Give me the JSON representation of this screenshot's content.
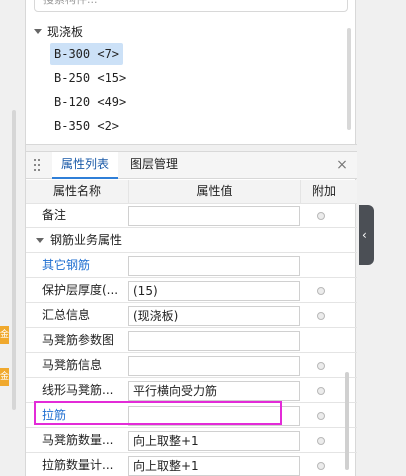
{
  "search": {
    "text": "搜索构件..."
  },
  "tree": {
    "group_label": "现浇板",
    "items": [
      {
        "label": "B-300 <7>",
        "selected": true
      },
      {
        "label": "B-250 <15>",
        "selected": false
      },
      {
        "label": "B-120 <49>",
        "selected": false
      },
      {
        "label": "B-350 <2>",
        "selected": false
      }
    ]
  },
  "left_badges": [
    "金",
    "金"
  ],
  "panel": {
    "tabs": [
      {
        "label": "属性列表",
        "active": true
      },
      {
        "label": "图层管理",
        "active": false
      }
    ],
    "close_glyph": "×"
  },
  "grid": {
    "headers": {
      "name": "属性名称",
      "value": "属性值",
      "add": "附加"
    },
    "rows": [
      {
        "type": "prop",
        "name": "备注",
        "value": "",
        "blue": false,
        "checkbox": true
      },
      {
        "type": "group",
        "name": "钢筋业务属性"
      },
      {
        "type": "prop",
        "name": "其它钢筋",
        "value": "",
        "blue": true,
        "checkbox": false
      },
      {
        "type": "prop",
        "name": "保护层厚度(...",
        "value": "(15)",
        "blue": false,
        "checkbox": true
      },
      {
        "type": "prop",
        "name": "汇总信息",
        "value": "(现浇板)",
        "blue": false,
        "checkbox": true
      },
      {
        "type": "prop",
        "name": "马凳筋参数图",
        "value": "",
        "blue": false,
        "checkbox": false
      },
      {
        "type": "prop",
        "name": "马凳筋信息",
        "value": "",
        "blue": false,
        "checkbox": true
      },
      {
        "type": "prop",
        "name": "线形马凳筋...",
        "value": "平行横向受力筋",
        "blue": false,
        "checkbox": true
      },
      {
        "type": "prop",
        "name": "拉筋",
        "value": "",
        "blue": true,
        "checkbox": true
      },
      {
        "type": "prop",
        "name": "马凳筋数量...",
        "value": "向上取整+1",
        "blue": false,
        "checkbox": true
      },
      {
        "type": "prop",
        "name": "拉筋数量计...",
        "value": "向上取整+1",
        "blue": false,
        "checkbox": true
      }
    ]
  },
  "colors": {
    "accent": "#2f7fd8",
    "highlight": "#e32bd8",
    "link_blue": "#1f6fd1"
  }
}
